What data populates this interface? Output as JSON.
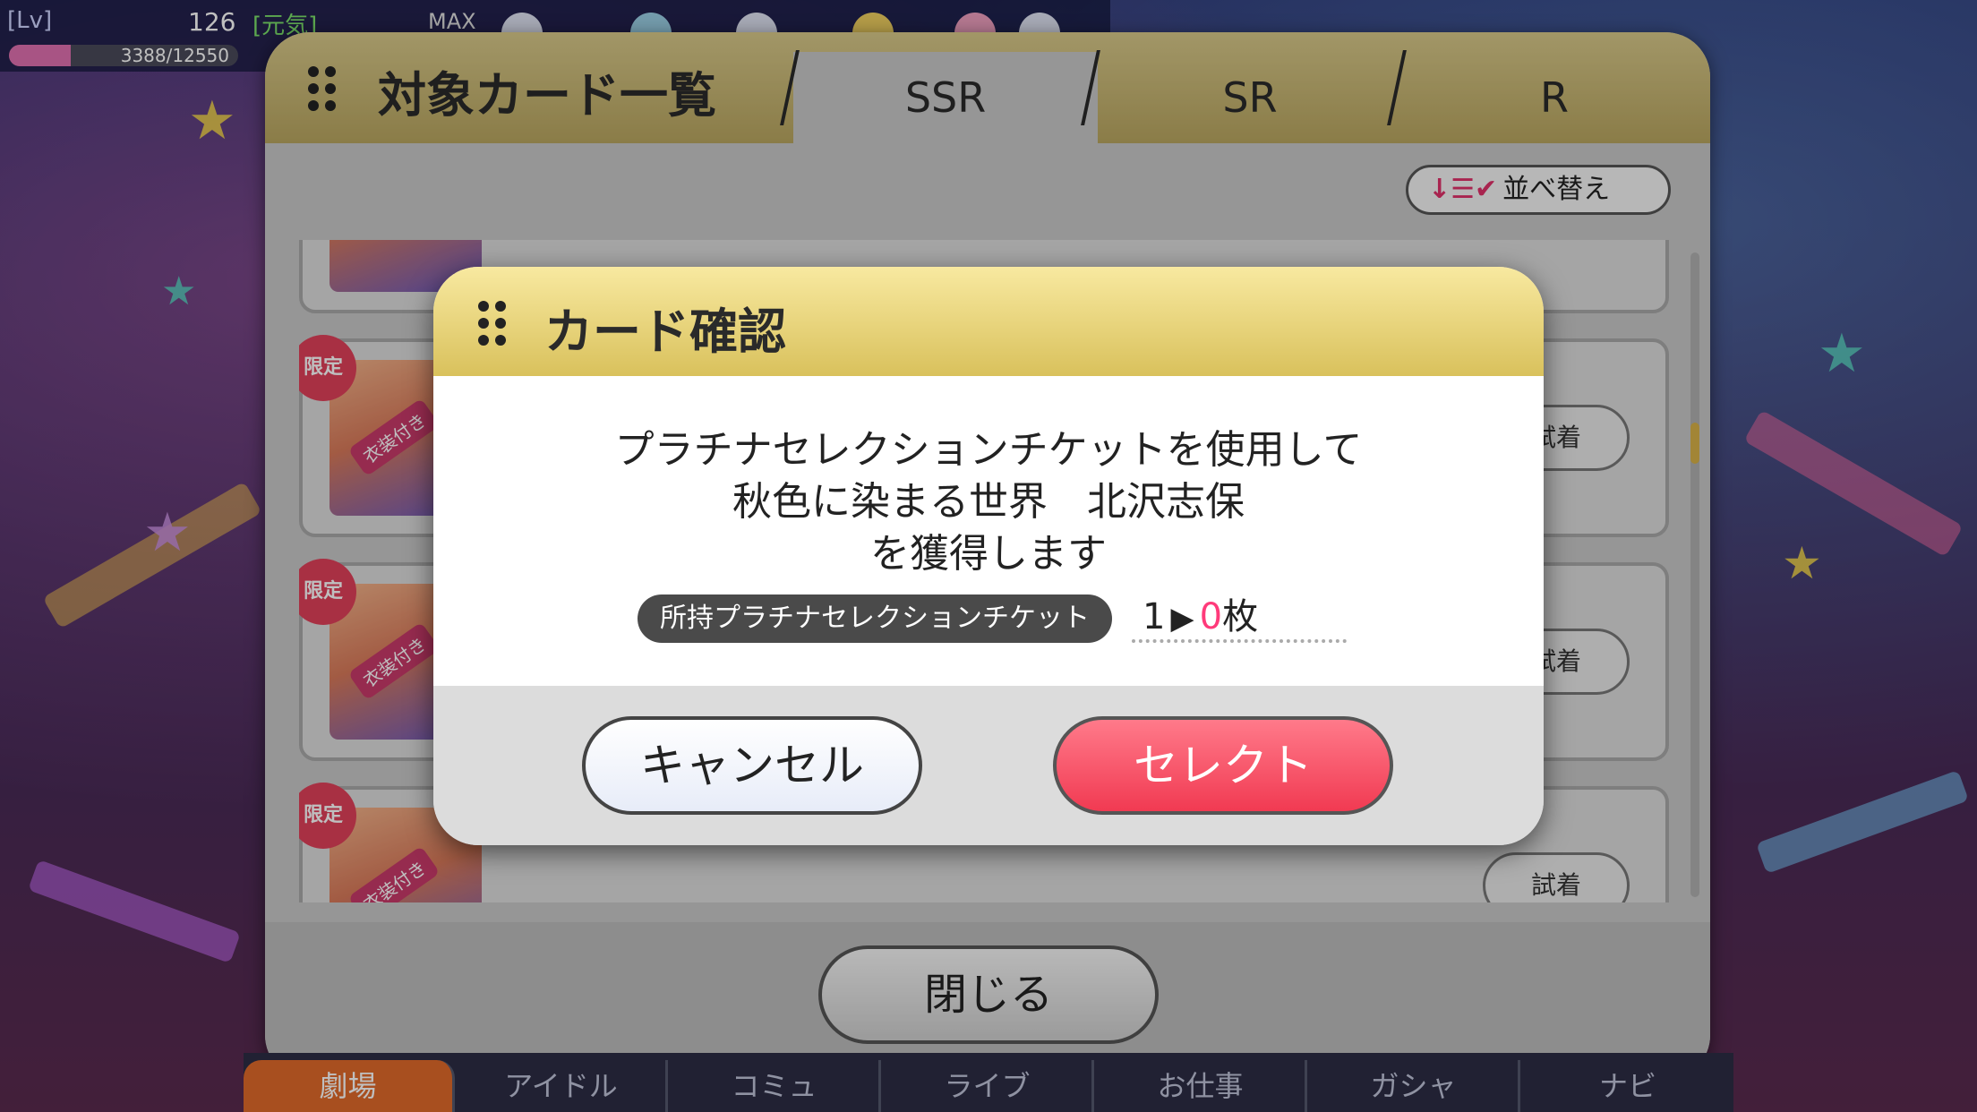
{
  "status": {
    "lv_label": "[Lv]",
    "level": "126",
    "mood": "[元気]",
    "max_label": "MAX",
    "exp": "3388/12550",
    "exp_fraction": 0.27
  },
  "panel": {
    "title": "対象カード一覧",
    "tabs": [
      "SSR",
      "SR",
      "R"
    ],
    "active_tab": "SSR",
    "sort_label": "並べ替え",
    "close_label": "閉じる",
    "limited_badge": "限定",
    "costume_badge": "衣装付き",
    "try_on_label": "試着"
  },
  "dialog": {
    "title": "カード確認",
    "line1": "プラチナセレクションチケットを使用して",
    "line2": "秋色に染まる世界　北沢志保",
    "line3": "を獲得します",
    "ticket_label": "所持プラチナセレクションチケット",
    "ticket_before": "1",
    "ticket_after": "0",
    "ticket_unit": "枚",
    "cancel_label": "キャンセル",
    "select_label": "セレクト"
  },
  "bottom_nav": {
    "items": [
      "劇場",
      "アイドル",
      "コミュ",
      "ライブ",
      "お仕事",
      "ガシャ",
      "ナビ"
    ]
  }
}
